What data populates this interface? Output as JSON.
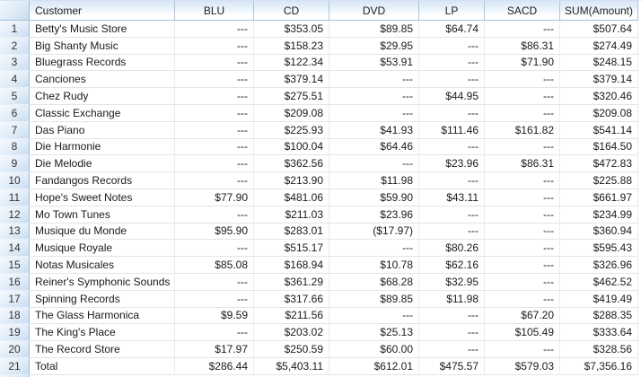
{
  "table": {
    "empty_value": "---",
    "columns": [
      {
        "key": "customer",
        "label": "Customer"
      },
      {
        "key": "blu",
        "label": "BLU"
      },
      {
        "key": "cd",
        "label": "CD"
      },
      {
        "key": "dvd",
        "label": "DVD"
      },
      {
        "key": "lp",
        "label": "LP"
      },
      {
        "key": "sacd",
        "label": "SACD"
      },
      {
        "key": "sum",
        "label": "SUM(Amount)"
      }
    ],
    "rows": [
      {
        "num": "1",
        "customer": "Betty's Music Store",
        "blu": "---",
        "cd": "$353.05",
        "dvd": "$89.85",
        "lp": "$64.74",
        "sacd": "---",
        "sum": "$507.64"
      },
      {
        "num": "2",
        "customer": "Big Shanty Music",
        "blu": "---",
        "cd": "$158.23",
        "dvd": "$29.95",
        "lp": "---",
        "sacd": "$86.31",
        "sum": "$274.49"
      },
      {
        "num": "3",
        "customer": "Bluegrass Records",
        "blu": "---",
        "cd": "$122.34",
        "dvd": "$53.91",
        "lp": "---",
        "sacd": "$71.90",
        "sum": "$248.15"
      },
      {
        "num": "4",
        "customer": "Canciones",
        "blu": "---",
        "cd": "$379.14",
        "dvd": "---",
        "lp": "---",
        "sacd": "---",
        "sum": "$379.14"
      },
      {
        "num": "5",
        "customer": "Chez Rudy",
        "blu": "---",
        "cd": "$275.51",
        "dvd": "---",
        "lp": "$44.95",
        "sacd": "---",
        "sum": "$320.46"
      },
      {
        "num": "6",
        "customer": "Classic Exchange",
        "blu": "---",
        "cd": "$209.08",
        "dvd": "---",
        "lp": "---",
        "sacd": "---",
        "sum": "$209.08"
      },
      {
        "num": "7",
        "customer": "Das Piano",
        "blu": "---",
        "cd": "$225.93",
        "dvd": "$41.93",
        "lp": "$111.46",
        "sacd": "$161.82",
        "sum": "$541.14"
      },
      {
        "num": "8",
        "customer": "Die Harmonie",
        "blu": "---",
        "cd": "$100.04",
        "dvd": "$64.46",
        "lp": "---",
        "sacd": "---",
        "sum": "$164.50"
      },
      {
        "num": "9",
        "customer": "Die Melodie",
        "blu": "---",
        "cd": "$362.56",
        "dvd": "---",
        "lp": "$23.96",
        "sacd": "$86.31",
        "sum": "$472.83"
      },
      {
        "num": "10",
        "customer": "Fandangos Records",
        "blu": "---",
        "cd": "$213.90",
        "dvd": "$11.98",
        "lp": "---",
        "sacd": "---",
        "sum": "$225.88"
      },
      {
        "num": "11",
        "customer": "Hope's Sweet Notes",
        "blu": "$77.90",
        "cd": "$481.06",
        "dvd": "$59.90",
        "lp": "$43.11",
        "sacd": "---",
        "sum": "$661.97"
      },
      {
        "num": "12",
        "customer": "Mo Town Tunes",
        "blu": "---",
        "cd": "$211.03",
        "dvd": "$23.96",
        "lp": "---",
        "sacd": "---",
        "sum": "$234.99"
      },
      {
        "num": "13",
        "customer": "Musique du Monde",
        "blu": "$95.90",
        "cd": "$283.01",
        "dvd": "($17.97)",
        "lp": "---",
        "sacd": "---",
        "sum": "$360.94"
      },
      {
        "num": "14",
        "customer": "Musique Royale",
        "blu": "---",
        "cd": "$515.17",
        "dvd": "---",
        "lp": "$80.26",
        "sacd": "---",
        "sum": "$595.43"
      },
      {
        "num": "15",
        "customer": "Notas Musicales",
        "blu": "$85.08",
        "cd": "$168.94",
        "dvd": "$10.78",
        "lp": "$62.16",
        "sacd": "---",
        "sum": "$326.96"
      },
      {
        "num": "16",
        "customer": "Reiner's Symphonic Sounds",
        "blu": "---",
        "cd": "$361.29",
        "dvd": "$68.28",
        "lp": "$32.95",
        "sacd": "---",
        "sum": "$462.52"
      },
      {
        "num": "17",
        "customer": "Spinning Records",
        "blu": "---",
        "cd": "$317.66",
        "dvd": "$89.85",
        "lp": "$11.98",
        "sacd": "---",
        "sum": "$419.49"
      },
      {
        "num": "18",
        "customer": "The Glass Harmonica",
        "blu": "$9.59",
        "cd": "$211.56",
        "dvd": "---",
        "lp": "---",
        "sacd": "$67.20",
        "sum": "$288.35"
      },
      {
        "num": "19",
        "customer": "The King's Place",
        "blu": "---",
        "cd": "$203.02",
        "dvd": "$25.13",
        "lp": "---",
        "sacd": "$105.49",
        "sum": "$333.64"
      },
      {
        "num": "20",
        "customer": "The Record Store",
        "blu": "$17.97",
        "cd": "$250.59",
        "dvd": "$60.00",
        "lp": "---",
        "sacd": "---",
        "sum": "$328.56"
      },
      {
        "num": "21",
        "customer": "Total",
        "blu": "$286.44",
        "cd": "$5,403.11",
        "dvd": "$612.01",
        "lp": "$475.57",
        "sacd": "$579.03",
        "sum": "$7,356.16"
      }
    ]
  },
  "colors": {
    "header_gradient_top": "#d8e7f6",
    "header_border": "#a3bfda",
    "row_indicator_gradient": "#c9ddf0",
    "row_indicator_border": "#9fbddb",
    "grid_line": "#e4e4e4",
    "cell_text": "#1a1a1a"
  }
}
